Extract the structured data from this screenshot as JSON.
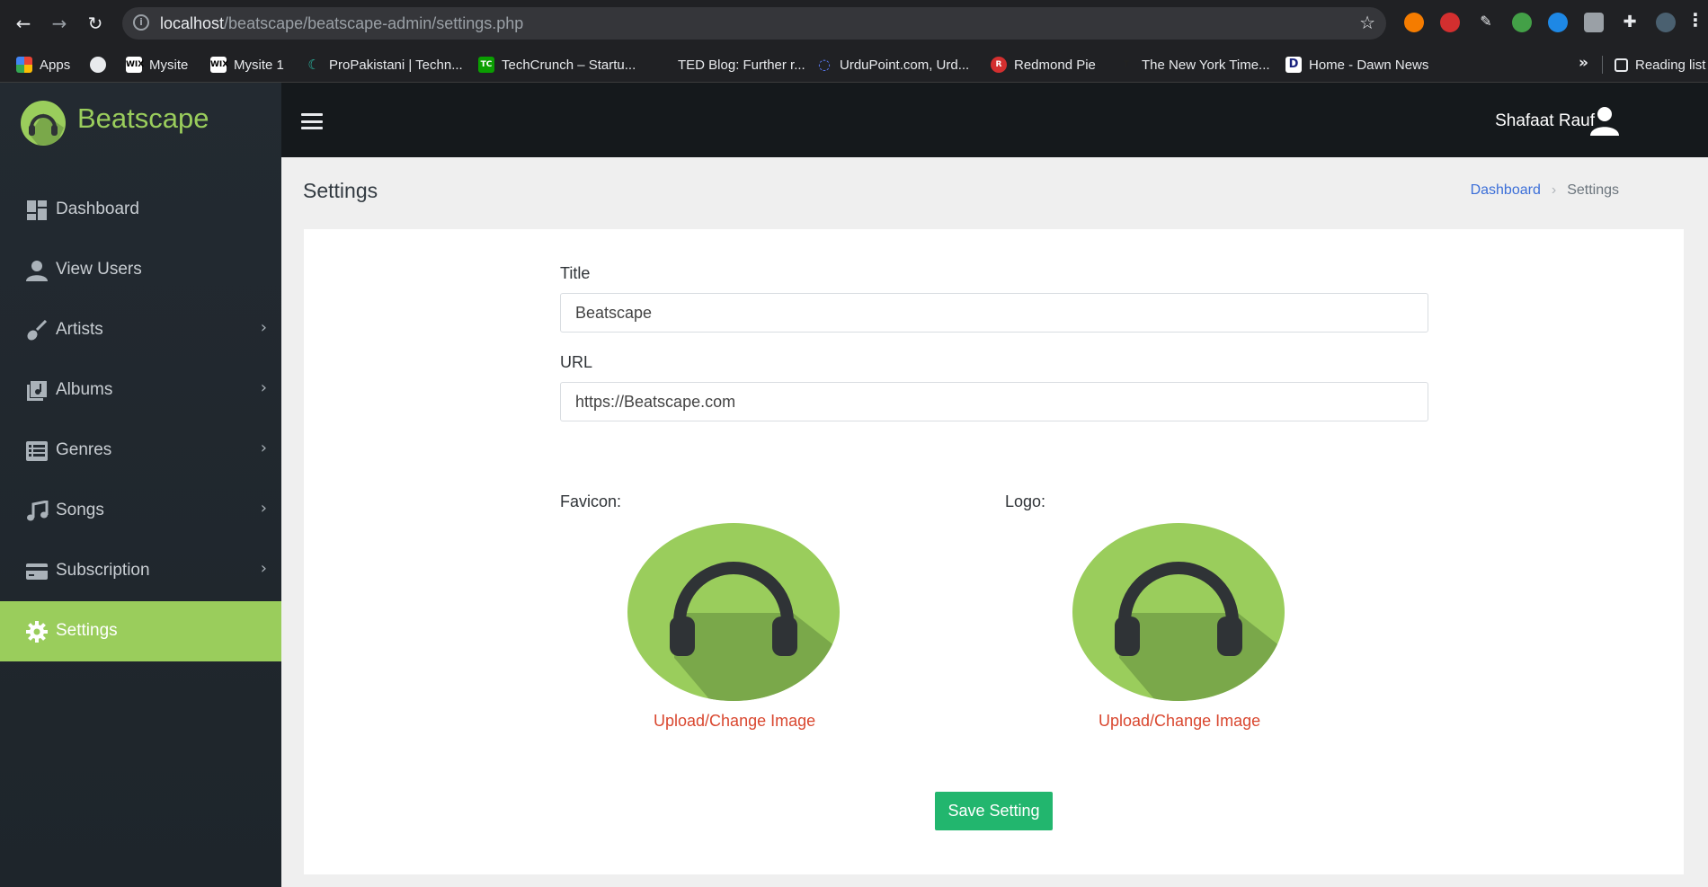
{
  "browser": {
    "url_host": "localhost",
    "url_path": "/beatscape/beatscape-admin/settings.php",
    "bookmarks": [
      {
        "label": "Apps"
      },
      {
        "label": ""
      },
      {
        "label": "Mysite"
      },
      {
        "label": "Mysite 1"
      },
      {
        "label": "ProPakistani | Techn..."
      },
      {
        "label": "TechCrunch – Startu..."
      },
      {
        "label": "TED Blog: Further r..."
      },
      {
        "label": "UrduPoint.com, Urd..."
      },
      {
        "label": "Redmond Pie"
      },
      {
        "label": "The New York Time..."
      },
      {
        "label": "Home - Dawn News"
      }
    ],
    "more_label": "»",
    "reading_list": "Reading list"
  },
  "sidebar": {
    "brand": "Beatscape",
    "items": [
      {
        "label": "Dashboard",
        "icon": "dashboard-icon",
        "has_submenu": false
      },
      {
        "label": "View Users",
        "icon": "user-icon",
        "has_submenu": false
      },
      {
        "label": "Artists",
        "icon": "guitar-icon",
        "has_submenu": true
      },
      {
        "label": "Albums",
        "icon": "album-icon",
        "has_submenu": true
      },
      {
        "label": "Genres",
        "icon": "list-icon",
        "has_submenu": true
      },
      {
        "label": "Songs",
        "icon": "music-note-icon",
        "has_submenu": true
      },
      {
        "label": "Subscription",
        "icon": "credit-card-icon",
        "has_submenu": true
      },
      {
        "label": "Settings",
        "icon": "gear-icon",
        "has_submenu": false,
        "active": true
      }
    ]
  },
  "navbar": {
    "user_name": "Shafaat Rauf"
  },
  "page": {
    "title": "Settings",
    "breadcrumb": {
      "link": "Dashboard",
      "current": "Settings"
    }
  },
  "form": {
    "title_label": "Title",
    "title_value": "Beatscape",
    "url_label": "URL",
    "url_value": "https://Beatscape.com",
    "favicon_label": "Favicon:",
    "logo_label": "Logo:",
    "upload_label": "Upload/Change Image",
    "save_label": "Save Setting"
  },
  "colors": {
    "accent": "#9acd5c",
    "save_button": "#22b66e",
    "upload_link": "#d9472f",
    "breadcrumb_link": "#3c6fd8"
  }
}
